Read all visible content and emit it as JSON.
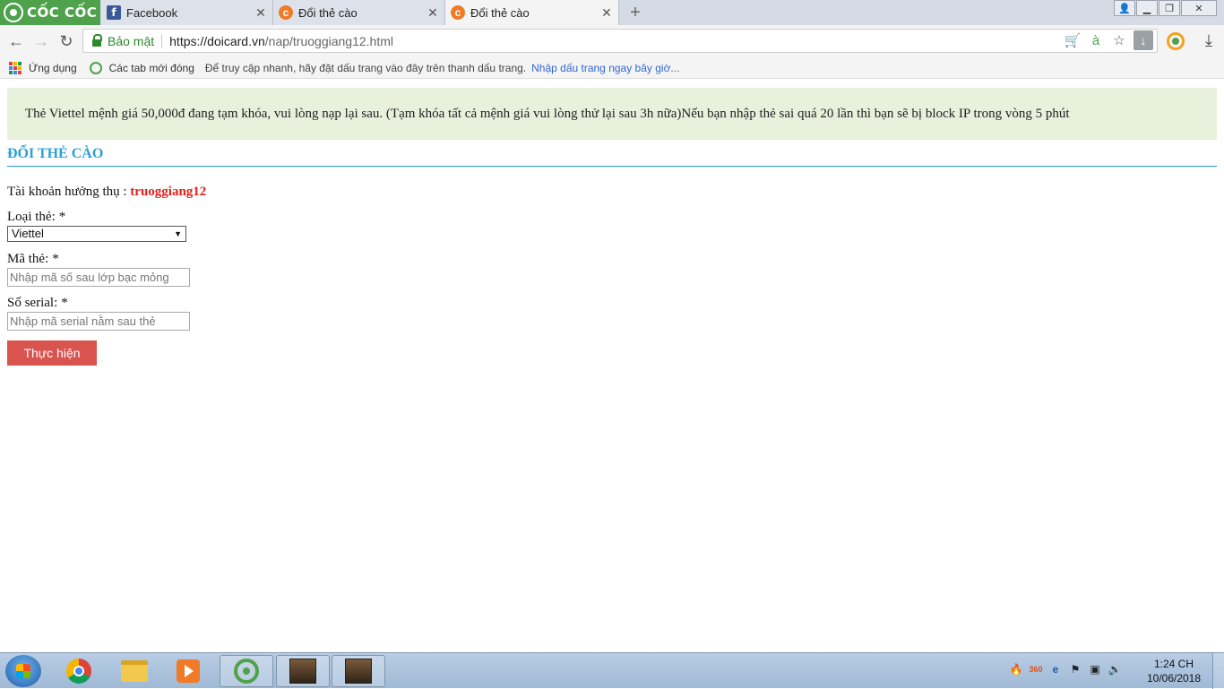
{
  "browser": {
    "brand": "CỐC CỐC",
    "tabs": [
      {
        "title": "Facebook",
        "favicon": "facebook-icon"
      },
      {
        "title": "Đổi thẻ cào",
        "favicon": "coccoc-icon"
      },
      {
        "title": "Đổi thẻ cào",
        "favicon": "coccoc-icon",
        "active": true
      }
    ],
    "new_tab_symbol": "+",
    "address": {
      "secure_label": "Bảo mật",
      "host": "https://doicard.vn",
      "path": "/nap/truoggiang12.html"
    },
    "bookmarks": {
      "apps": "Ứng dụng",
      "recent_tabs": "Các tab mới đóng",
      "hint": "Để truy cập nhanh, hãy đặt dấu trang vào đây trên thanh dấu trang.",
      "import_link": "Nhập dấu trang ngay bây giờ..."
    }
  },
  "page": {
    "alert": "Thẻ Viettel mệnh giá 50,000đ đang tạm khóa, vui lòng nạp lại sau. (Tạm khóa tất cả mệnh giá vui lòng thử lại sau 3h nữa)Nếu bạn nhập thẻ sai quá 20 lần thì bạn sẽ bị block IP trong vòng 5 phút",
    "heading": "ĐỔI THẺ CÀO",
    "account_label": "Tài khoản hưởng thụ :",
    "account_name": "truoggiang12",
    "card_type_label": "Loại thẻ:",
    "card_type_value": "Viettel",
    "card_code_label": "Mã thẻ:",
    "card_code_placeholder": "Nhập mã số sau lớp bạc mỏng",
    "serial_label": "Số serial:",
    "serial_placeholder": "Nhập mã serial nằm sau thẻ",
    "required_mark": "*",
    "submit_label": "Thực hiện"
  },
  "taskbar": {
    "time": "1:24 CH",
    "date": "10/06/2018"
  },
  "colors": {
    "brand_green": "#4fa24b",
    "alert_bg": "#e8f1dc",
    "heading_blue": "#2b9fd8",
    "account_red": "#e02020",
    "submit_red": "#d9534f"
  }
}
